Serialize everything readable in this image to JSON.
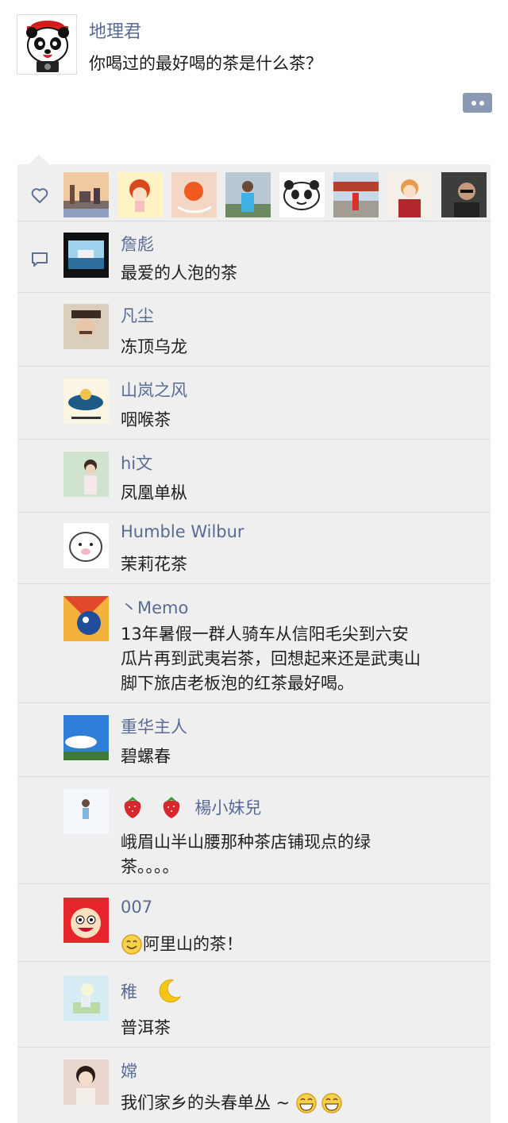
{
  "post": {
    "author": "地理君",
    "text": "你喝过的最好喝的茶是什么茶？"
  },
  "comments": [
    {
      "name": "詹彪",
      "text": "最爱的人泡的茶"
    },
    {
      "name": "凡尘",
      "text": "冻顶乌龙"
    },
    {
      "name": "山岚之风",
      "text": "咽喉茶"
    },
    {
      "name": "hi文",
      "text": "凤凰单枞"
    },
    {
      "name": "Humble Wilbur",
      "text": "茉莉花茶"
    },
    {
      "name": "丶Memo",
      "text_lines": [
        "13年暑假一群人骑车从信阳毛尖到六安",
        "瓜片再到武夷岩茶，回想起来还是武夷山",
        "脚下旅店老板泡的红茶最好喝。"
      ]
    },
    {
      "name": "重华主人",
      "text": "碧螺春"
    },
    {
      "name": "楊小妹兒",
      "name_prefix_icons": [
        "strawberry-icon",
        "strawberry-icon"
      ],
      "text_lines": [
        "峨眉山半山腰那种茶店铺现点的绿",
        "茶。。。。"
      ]
    },
    {
      "name": "007",
      "text_prefix_icon": "smile-emoji-icon",
      "text": "阿里山的茶！"
    },
    {
      "name": "稚",
      "name_suffix_icon": "moon-icon",
      "text": "普洱茶"
    },
    {
      "name": "嫦",
      "text": "我们家乡的头春单丛 ~",
      "text_suffix_icons": [
        "grin-emoji-icon",
        "grin-emoji-icon"
      ]
    }
  ],
  "colors": {
    "name_link": "#586b95",
    "panel_bg": "#efefef",
    "divider": "#dcdcdc",
    "more_button": "#8a9ab5"
  }
}
